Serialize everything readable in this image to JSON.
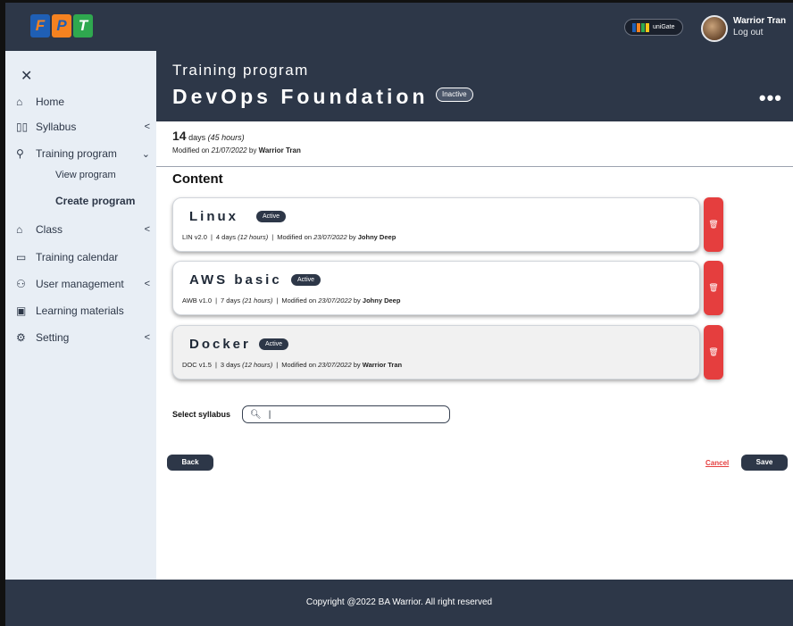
{
  "header": {
    "logo_letters": [
      "F",
      "P",
      "T"
    ],
    "unigate_label": "uniGate",
    "user_name": "Warrior Tran",
    "logout_label": "Log out"
  },
  "sidebar": {
    "close_icon": "close-icon",
    "items": [
      {
        "label": "Home",
        "icon": "home-icon"
      },
      {
        "label": "Syllabus",
        "icon": "book-icon",
        "chevron": "<"
      },
      {
        "label": "Training program",
        "icon": "microscope-icon",
        "chevron": "⌄"
      },
      {
        "label": "Class",
        "icon": "graduation-cap-icon",
        "chevron": "<"
      },
      {
        "label": "Training calendar",
        "icon": "calendar-icon"
      },
      {
        "label": "User management",
        "icon": "users-icon",
        "chevron": "<"
      },
      {
        "label": "Learning materials",
        "icon": "folder-icon"
      },
      {
        "label": "Setting",
        "icon": "gear-icon",
        "chevron": "<"
      }
    ],
    "subitems": [
      {
        "label": "View program",
        "active": false
      },
      {
        "label": "Create program",
        "active": true
      }
    ]
  },
  "title": {
    "label": "Training program",
    "name": "DevOps Foundation",
    "status": "Inactive",
    "more": "•••"
  },
  "info": {
    "days": "14",
    "days_unit": "days",
    "hours": "(45 hours)",
    "modified_prefix": "Modified on",
    "modified_date": "21/07/2022",
    "modified_by_prefix": "by",
    "modified_by": "Warrior Tran"
  },
  "content": {
    "heading": "Content",
    "cards": [
      {
        "title": "Linux",
        "status": "Active",
        "code": "LIN v2.0",
        "days": "4 days",
        "hours": "(12 hours)",
        "modified_prefix": "Modified on",
        "date": "23/07/2022",
        "by_prefix": "by",
        "by": "Johny Deep"
      },
      {
        "title": "AWS basic",
        "status": "Active",
        "code": "AWB v1.0",
        "days": "7 days",
        "hours": "(21 hours)",
        "modified_prefix": "Modified on",
        "date": "23/07/2022",
        "by_prefix": "by",
        "by": "Johny Deep"
      },
      {
        "title": "Docker",
        "status": "Active",
        "code": "DOC v1.5",
        "days": "3 days",
        "hours": "(12 hours)",
        "modified_prefix": "Modified on",
        "date": "23/07/2022",
        "by_prefix": "by",
        "by": "Warrior Tran"
      }
    ]
  },
  "select_syllabus": {
    "label": "Select syllabus",
    "value": "|"
  },
  "actions": {
    "back": "Back",
    "cancel": "Cancel",
    "save": "Save"
  },
  "footer": {
    "text": "Copyright @2022 BA Warrior. All right reserved"
  },
  "colors": {
    "header_bg": "#2d3748",
    "sidebar_bg": "#e8eef5",
    "danger": "#e53e3e"
  }
}
